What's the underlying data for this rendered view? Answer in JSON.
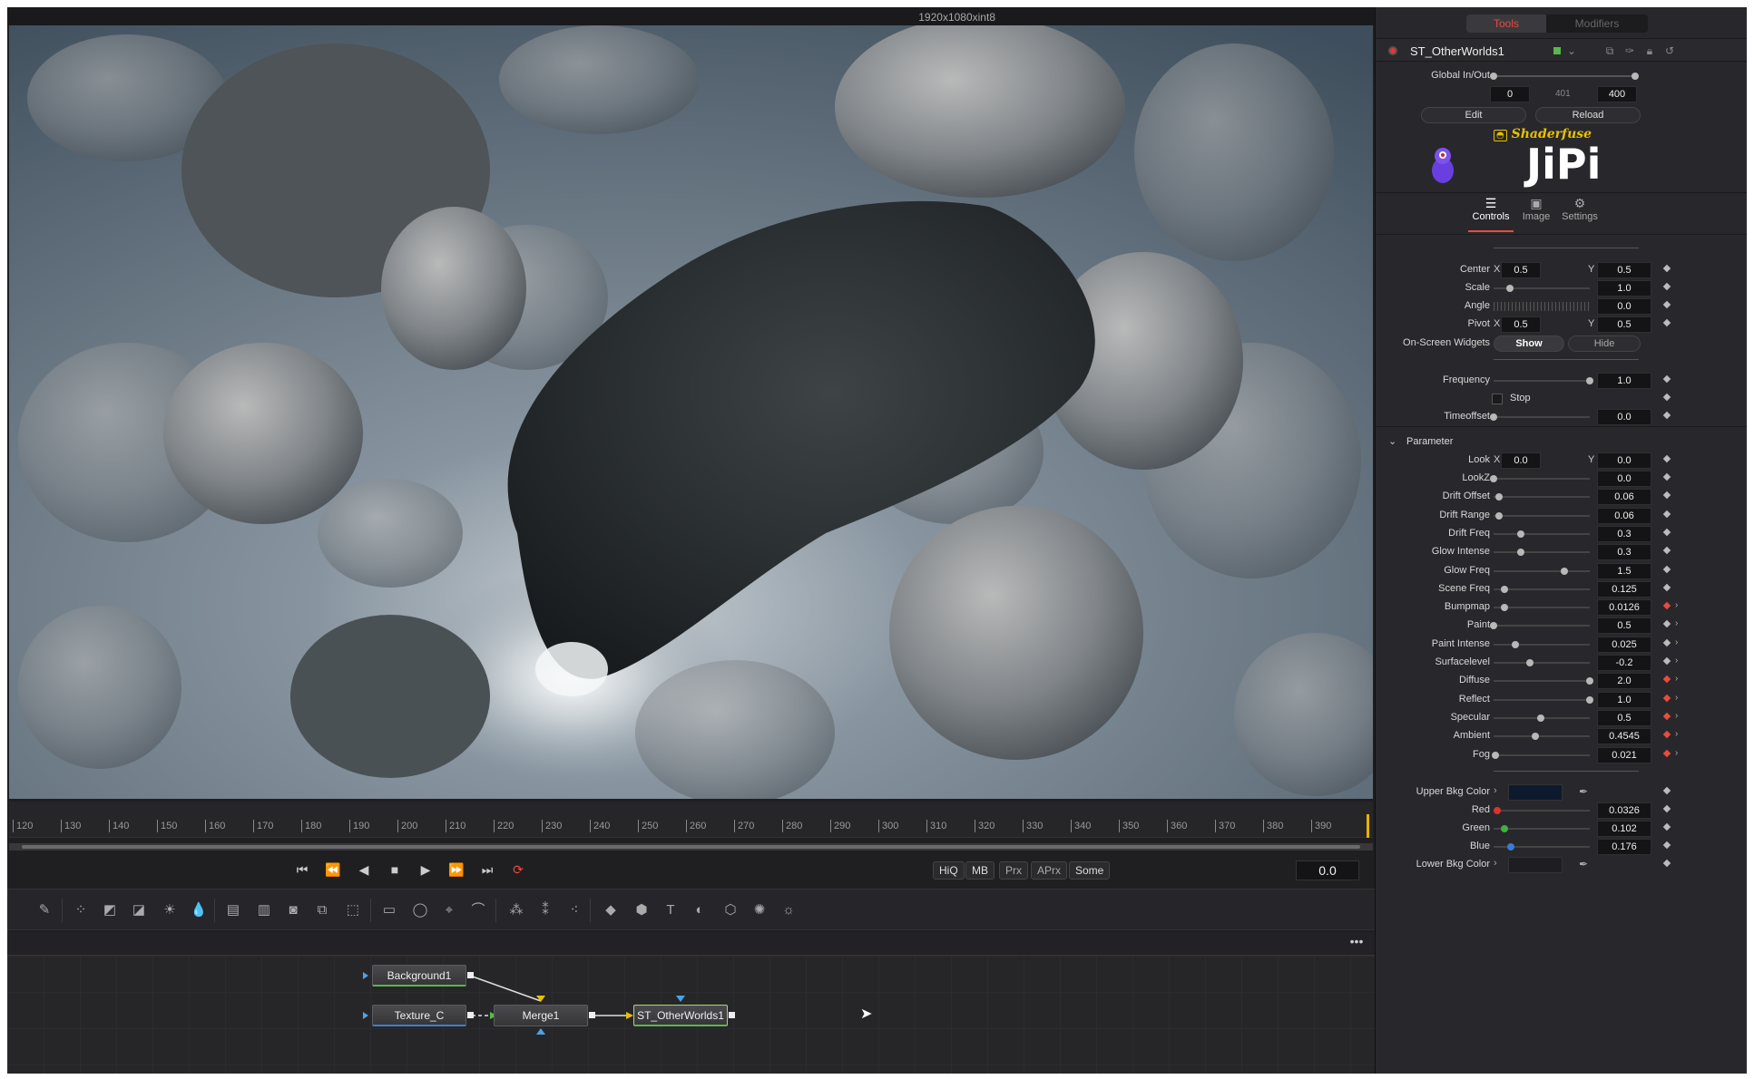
{
  "viewer": {
    "resolution": "1920x1080xint8"
  },
  "timeline": {
    "ticks": [
      "120",
      "130",
      "140",
      "150",
      "160",
      "170",
      "180",
      "190",
      "200",
      "210",
      "220",
      "230",
      "240",
      "250",
      "260",
      "270",
      "280",
      "290",
      "300",
      "310",
      "320",
      "330",
      "340",
      "350",
      "360",
      "370",
      "380",
      "390"
    ]
  },
  "transport": {
    "quality_buttons": [
      "HiQ",
      "MB",
      "Prx",
      "APrx",
      "Some"
    ],
    "current_time": "0.0"
  },
  "nodes": {
    "background": "Background1",
    "texture": "Texture_C",
    "merge": "Merge1",
    "shader": "ST_OtherWorlds1"
  },
  "inspector": {
    "tabs": {
      "tools": "Tools",
      "modifiers": "Modifiers"
    },
    "tool_name": "ST_OtherWorlds1",
    "global_inout": {
      "label": "Global In/Out",
      "start": "0",
      "mid": "401",
      "end": "400"
    },
    "edit_label": "Edit",
    "reload_label": "Reload",
    "shaderfuse_label": "Shaderfuse",
    "author_logo": "JiPi",
    "subtabs": [
      {
        "label": "Controls"
      },
      {
        "label": "Image"
      },
      {
        "label": "Settings"
      }
    ],
    "center": {
      "label": "Center",
      "x_axis": "X",
      "x": "0.5",
      "y_axis": "Y",
      "y": "0.5"
    },
    "scale": {
      "label": "Scale",
      "value": "1.0"
    },
    "angle": {
      "label": "Angle",
      "value": "0.0"
    },
    "pivot": {
      "label": "Pivot",
      "x_axis": "X",
      "x": "0.5",
      "y_axis": "Y",
      "y": "0.5"
    },
    "widgets": {
      "label": "On-Screen Widgets",
      "show": "Show",
      "hide": "Hide"
    },
    "frequency": {
      "label": "Frequency",
      "value": "1.0"
    },
    "stop_label": "Stop",
    "timeoffset": {
      "label": "Timeoffset",
      "value": "0.0"
    },
    "parameter_section": "Parameter",
    "look": {
      "label": "Look",
      "x_axis": "X",
      "x": "0.0",
      "y_axis": "Y",
      "y": "0.0"
    },
    "params": [
      {
        "label": "LookZ",
        "value": "0.0"
      },
      {
        "label": "Drift Offset",
        "value": "0.06"
      },
      {
        "label": "Drift Range",
        "value": "0.06"
      },
      {
        "label": "Drift Freq",
        "value": "0.3"
      },
      {
        "label": "Glow Intense",
        "value": "0.3"
      },
      {
        "label": "Glow Freq",
        "value": "1.5"
      },
      {
        "label": "Scene Freq",
        "value": "0.125"
      },
      {
        "label": "Bumpmap",
        "value": "0.0126"
      },
      {
        "label": "Paint",
        "value": "0.5"
      },
      {
        "label": "Paint Intense",
        "value": "0.025"
      },
      {
        "label": "Surfacelevel",
        "value": "-0.2"
      },
      {
        "label": "Diffuse",
        "value": "2.0"
      },
      {
        "label": "Reflect",
        "value": "1.0"
      },
      {
        "label": "Specular",
        "value": "0.5"
      },
      {
        "label": "Ambient",
        "value": "0.4545"
      },
      {
        "label": "Fog",
        "value": "0.021"
      }
    ],
    "upper_bkg": {
      "label": "Upper Bkg Color",
      "color": "#0d1a2d"
    },
    "red": {
      "label": "Red",
      "value": "0.0326"
    },
    "green": {
      "label": "Green",
      "value": "0.102"
    },
    "blue": {
      "label": "Blue",
      "value": "0.176"
    },
    "lower_bkg": {
      "label": "Lower Bkg Color"
    }
  }
}
